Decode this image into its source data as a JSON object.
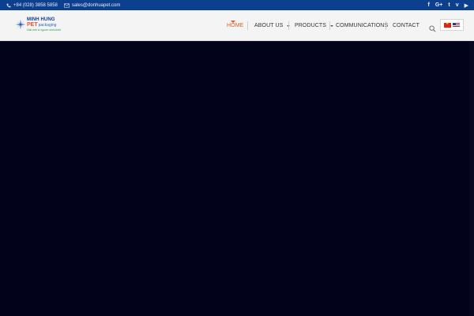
{
  "topbar": {
    "phone": "+84 (028) 3858 5858",
    "email": "sales@donhuapet.com",
    "social_icons": [
      "facebook-icon",
      "google-plus-icon",
      "twitter-icon",
      "vimeo-icon",
      "youtube-icon"
    ],
    "social_labels": [
      "f",
      "G+",
      "t",
      "v",
      "▶"
    ],
    "background": "#0d3f8f"
  },
  "logo": {
    "line1": "MINH HUNG",
    "line2": "PET",
    "line2_suffix": "packaging",
    "tagline": "Giải mới vì ngươn sinh khiết"
  },
  "nav": {
    "items": [
      {
        "label": "HOME",
        "active": true,
        "has_dropdown": false
      },
      {
        "label": "ABOUT US",
        "active": false,
        "has_dropdown": true
      },
      {
        "label": "PRODUCTS",
        "active": false,
        "has_dropdown": true
      },
      {
        "label": "COMMUNICATIONS",
        "active": false,
        "has_dropdown": false
      },
      {
        "label": "CONTACT",
        "active": false,
        "has_dropdown": false
      }
    ],
    "active_color": "#e05d22"
  },
  "languages": [
    "vietnamese-flag-icon",
    "us-flag-icon"
  ],
  "hero": {
    "background": "#02031a"
  }
}
